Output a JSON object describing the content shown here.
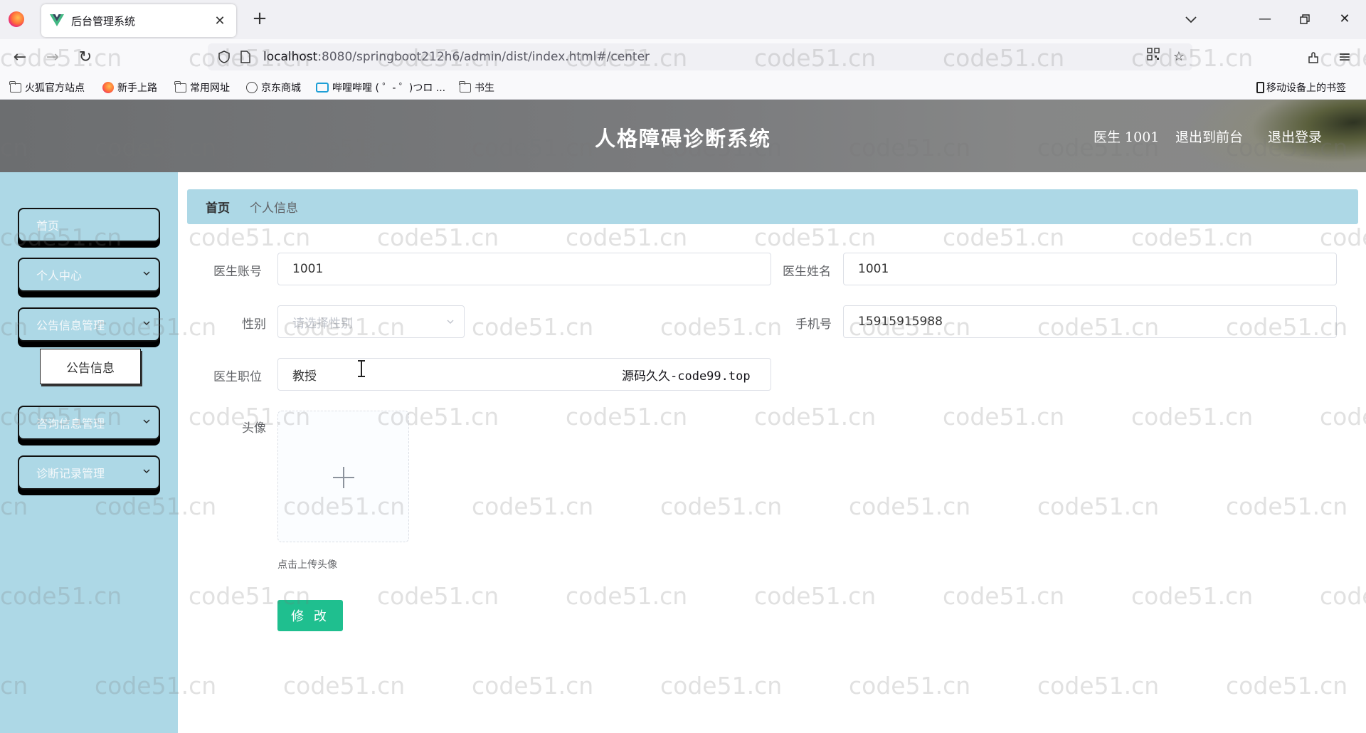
{
  "browser": {
    "tab_title": "后台管理系统",
    "url_host": "localhost",
    "url_rest": ":8080/springboot212h6/admin/dist/index.html#/center",
    "bookmarks": [
      "火狐官方站点",
      "新手上路",
      "常用网址",
      "京东商城",
      "哔哩哔哩 ( ゜- ゜)つロ ...",
      "书生"
    ],
    "mobile_bookmarks": "移动设备上的书签"
  },
  "header": {
    "title": "人格障碍诊断系统",
    "user": "医生 1001",
    "to_front": "退出到前台",
    "logout": "退出登录"
  },
  "sidebar": {
    "home": "首页",
    "personal_center": "个人中心",
    "notice_mgmt": "公告信息管理",
    "notice_sub": "公告信息",
    "consult_mgmt": "咨询信息管理",
    "diagnosis_mgmt": "诊断记录管理"
  },
  "breadcrumb": {
    "home": "首页",
    "current": "个人信息"
  },
  "form": {
    "account_label": "医生账号",
    "account_value": "1001",
    "name_label": "医生姓名",
    "name_value": "1001",
    "gender_label": "性别",
    "gender_placeholder": "请选择性别",
    "phone_label": "手机号",
    "phone_value": "15915915988",
    "title_label": "医生职位",
    "title_value": "教授",
    "avatar_label": "头像",
    "upload_hint": "点击上传头像",
    "submit": "修 改"
  },
  "overlay_text": "源码久久-code99.top",
  "watermark": "code51.cn",
  "colors": {
    "sidebar_bg": "#add8e6",
    "breadcrumb_bg": "#add8e6",
    "submit_bg": "#1fbf8f",
    "header_bg": "#7a7b7d"
  }
}
